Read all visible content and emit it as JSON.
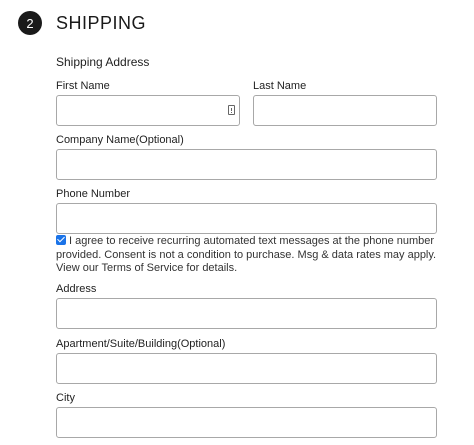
{
  "step": {
    "number": "2",
    "title": "SHIPPING"
  },
  "section_title": "Shipping Address",
  "fields": {
    "first_name": {
      "label": "First Name",
      "value": ""
    },
    "last_name": {
      "label": "Last Name",
      "value": ""
    },
    "company": {
      "label": "Company Name(Optional)",
      "value": ""
    },
    "phone": {
      "label": "Phone Number",
      "value": ""
    },
    "address": {
      "label": "Address",
      "value": ""
    },
    "apartment": {
      "label": "Apartment/Suite/Building(Optional)",
      "value": ""
    },
    "city": {
      "label": "City",
      "value": ""
    }
  },
  "consent": {
    "checked": true,
    "text": "I agree to receive recurring automated text messages at the phone number provided. Consent is not a condition to purchase. Msg & data rates may apply. View our Terms of Service for details."
  },
  "colors": {
    "step_circle": "#1a1a1a",
    "checkbox": "#1a73e8",
    "input_border": "#a8a8a8"
  }
}
